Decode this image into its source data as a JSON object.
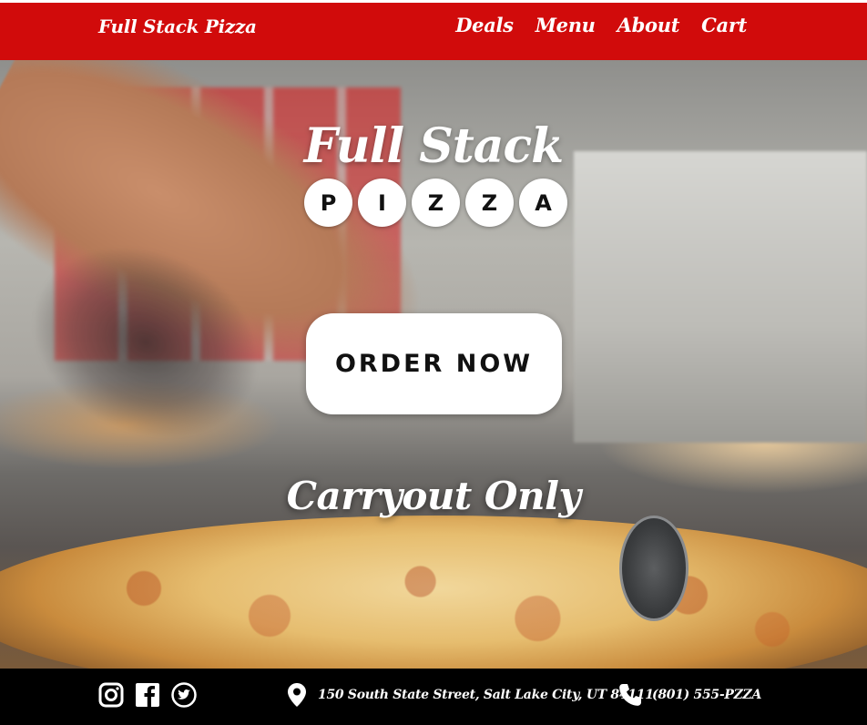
{
  "nav": {
    "brand": "Full Stack Pizza",
    "links": [
      "Deals",
      "Menu",
      "About",
      "Cart"
    ]
  },
  "hero": {
    "title": "Full Stack",
    "letters": [
      "P",
      "I",
      "Z",
      "Z",
      "A"
    ],
    "order_button": "ORDER NOW",
    "subtitle": "Carryout Only"
  },
  "footer": {
    "social_icons": [
      "instagram-icon",
      "facebook-icon",
      "twitter-icon"
    ],
    "address": "150 South State Street, Salt Lake City, UT 84111",
    "phone": "(801) 555-PZZA"
  },
  "colors": {
    "nav_bg": "#d10b0b",
    "footer_bg": "#000000",
    "button_bg": "#ffffff",
    "text_light": "#ffffff"
  }
}
